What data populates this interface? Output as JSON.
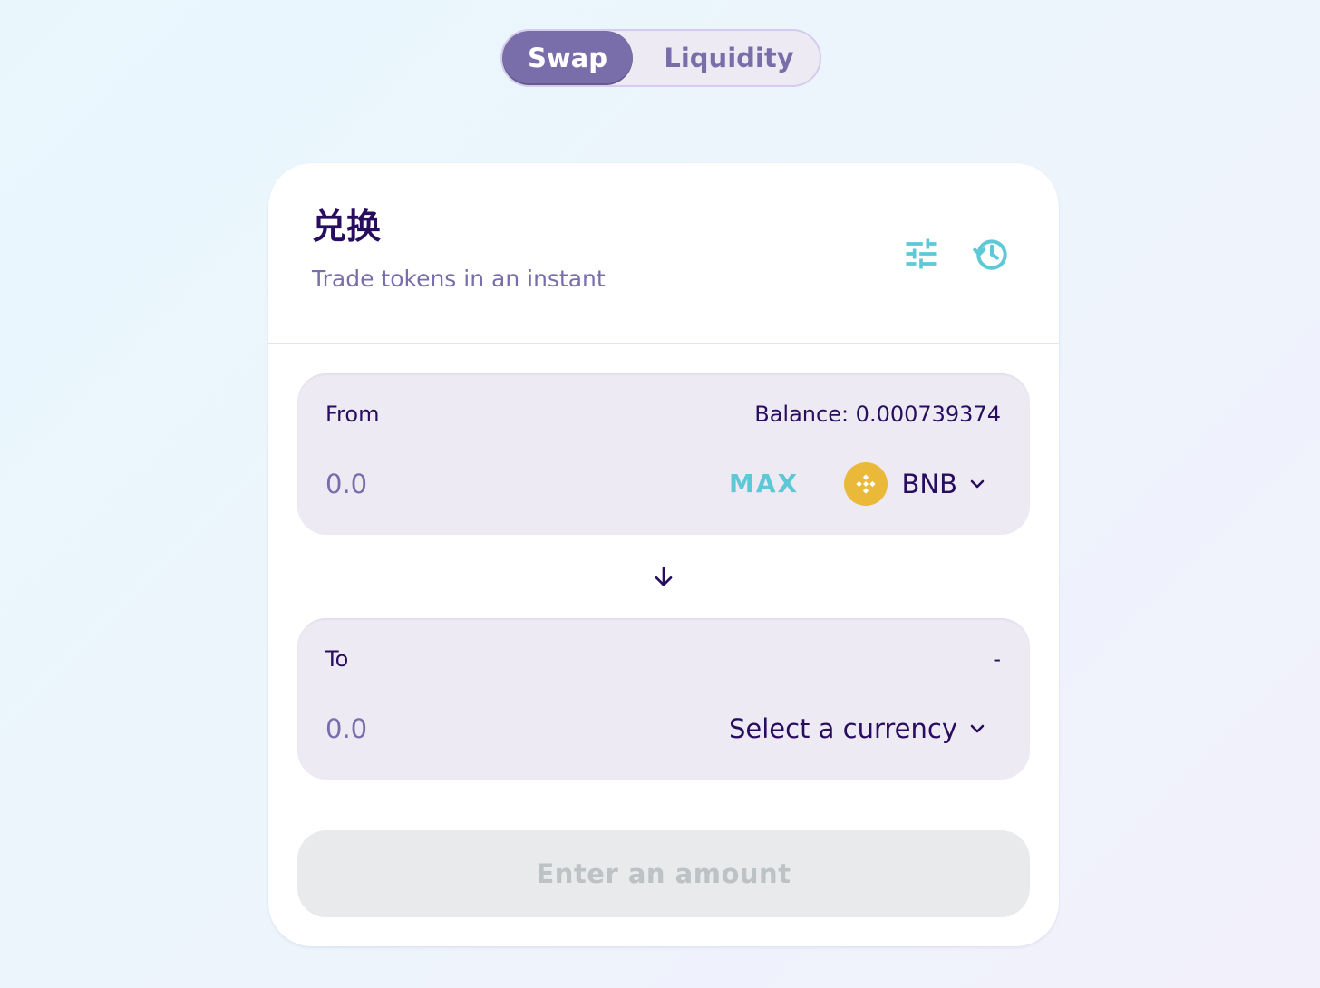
{
  "nav": {
    "tabs": [
      {
        "label": "Swap",
        "active": true
      },
      {
        "label": "Liquidity",
        "active": false
      }
    ]
  },
  "card": {
    "title": "兑换",
    "subtitle": "Trade tokens in an instant",
    "settings_icon": "settings-sliders-icon",
    "history_icon": "history-clock-icon"
  },
  "from": {
    "label": "From",
    "balance": "Balance: 0.000739374",
    "placeholder": "0.0",
    "max_label": "MAX",
    "token": "BNB",
    "token_icon": "bnb-logo-icon"
  },
  "to": {
    "label": "To",
    "balance": "-",
    "placeholder": "0.0",
    "currency_label": "Select a currency"
  },
  "action": {
    "label": "Enter an amount",
    "disabled": true
  },
  "colors": {
    "primary": "#7a6eaa",
    "text": "#280d5f",
    "accent": "#5ec8d6",
    "input_bg": "#eeeaf4",
    "bnb": "#eab93a",
    "disabled_bg": "#e9eaeb",
    "disabled_text": "#bdc2c4"
  }
}
